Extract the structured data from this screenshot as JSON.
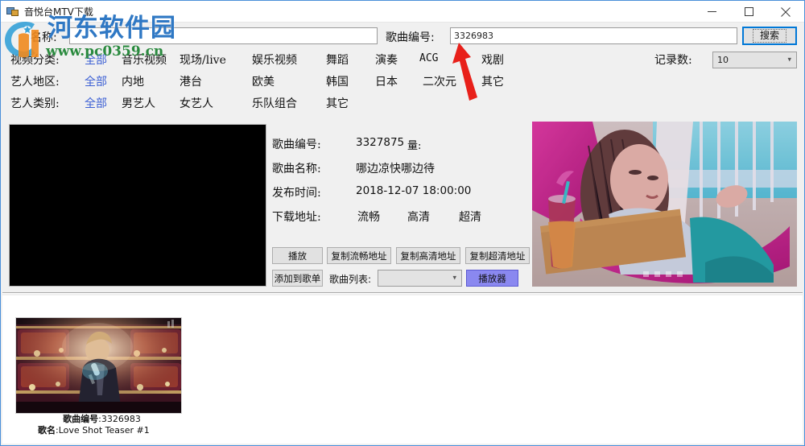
{
  "window": {
    "title": "音悦台MTV下载",
    "icon": "app-icon",
    "controls": {
      "minimize": "−",
      "maximize": "□",
      "close": "×"
    }
  },
  "search": {
    "name_label": "名称:",
    "name_value": "",
    "name_placeholder": "",
    "songno_label": "歌曲编号:",
    "songno_value": "3326983",
    "songno_placeholder": "",
    "search_button": "搜索",
    "record_count_label": "记录数:",
    "record_count_value": "10"
  },
  "filters": [
    {
      "label": "视频分类:",
      "items": [
        {
          "text": "全部",
          "selected": true
        },
        {
          "text": "音乐视频",
          "selected": false
        },
        {
          "text": "现场/live",
          "selected": false
        },
        {
          "text": "娱乐视频",
          "selected": false
        },
        {
          "text": "舞蹈",
          "selected": false
        },
        {
          "text": "演奏",
          "selected": false
        },
        {
          "text": "ACG",
          "selected": false
        },
        {
          "text": "戏剧",
          "selected": false
        }
      ]
    },
    {
      "label": "艺人地区:",
      "items": [
        {
          "text": "全部",
          "selected": true
        },
        {
          "text": "内地",
          "selected": false
        },
        {
          "text": "港台",
          "selected": false
        },
        {
          "text": "欧美",
          "selected": false
        },
        {
          "text": "韩国",
          "selected": false
        },
        {
          "text": "日本",
          "selected": false
        },
        {
          "text": "二次元",
          "selected": false
        },
        {
          "text": "其它",
          "selected": false
        }
      ]
    },
    {
      "label": "艺人类别:",
      "items": [
        {
          "text": "全部",
          "selected": true
        },
        {
          "text": "男艺人",
          "selected": false
        },
        {
          "text": "女艺人",
          "selected": false
        },
        {
          "text": "乐队组合",
          "selected": false
        },
        {
          "text": "其它",
          "selected": false
        }
      ]
    }
  ],
  "details": {
    "songno_label": "歌曲编号:",
    "songno_value": "3327875",
    "playcount_label": "量:",
    "songname_label": "歌曲名称:",
    "songname_value": "哪边凉快哪边待",
    "publish_label": "发布时间:",
    "publish_value": "2018-12-07  18:00:00",
    "download_label": "下载地址:",
    "download_links": [
      "流畅",
      "高清",
      "超清"
    ]
  },
  "actions": {
    "play": "播放",
    "copy_sd": "复制流畅地址",
    "copy_hd": "复制高清地址",
    "copy_uhd": "复制超清地址",
    "add_to_list": "添加到歌单",
    "songlist_label": "歌曲列表:",
    "songlist_value": "",
    "player": "播放器"
  },
  "results": [
    {
      "songno_key": "歌曲编号",
      "songno_value": "3326983",
      "name_key": "歌名",
      "name_value": "Love Shot Teaser #1"
    }
  ],
  "watermark": {
    "site_name": "河东软件园",
    "url": "www.pc0359.cn",
    "logo": "hedong-logo"
  },
  "annotation": {
    "arrow": "red-arrow-pointing-to-songno-field"
  },
  "colors": {
    "accent_blue": "#0078d7",
    "selected_filter": "#3b5fd4",
    "player_button": "#8a88f0",
    "watermark_blue": "#2f78c4",
    "watermark_green": "#2a8a3e",
    "arrow_red": "#e8201a",
    "window_bg": "#f0f0f0"
  }
}
